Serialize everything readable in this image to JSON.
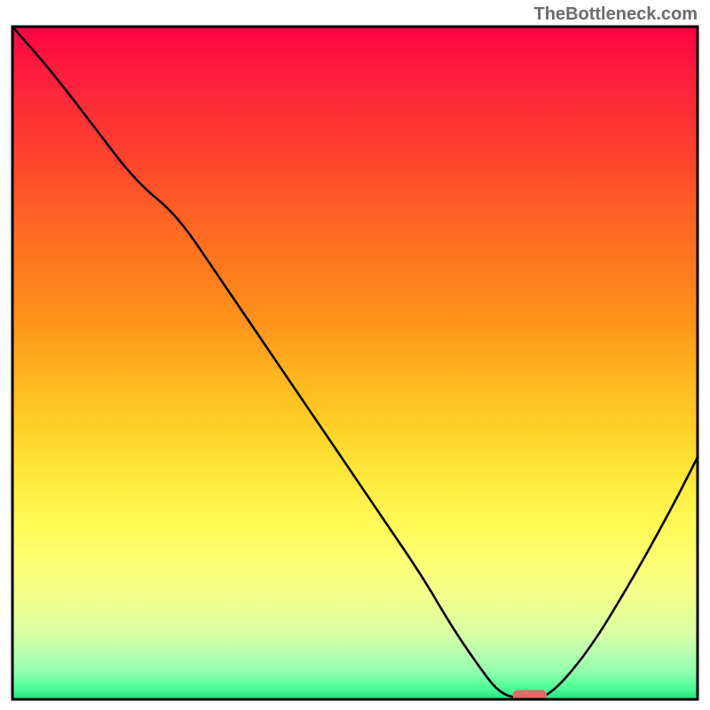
{
  "watermark": "TheBottleneck.com",
  "chart_data": {
    "type": "line",
    "title": "",
    "xlabel": "",
    "ylabel": "",
    "xlim": [
      0,
      100
    ],
    "ylim": [
      0,
      100
    ],
    "x": [
      0,
      6,
      12,
      18,
      24,
      30,
      36,
      42,
      48,
      54,
      60,
      64,
      68,
      71,
      74,
      78,
      84,
      90,
      96,
      100
    ],
    "y": [
      100,
      93,
      85,
      77,
      72,
      63,
      54,
      45,
      36,
      27,
      18,
      11,
      5,
      1,
      0,
      0,
      7,
      17,
      28,
      36
    ],
    "marker": {
      "x_range": [
        73,
        78
      ],
      "y": 0.6,
      "color": "#e06969"
    },
    "background": "vertical-gradient-red-to-green",
    "grid": false
  }
}
